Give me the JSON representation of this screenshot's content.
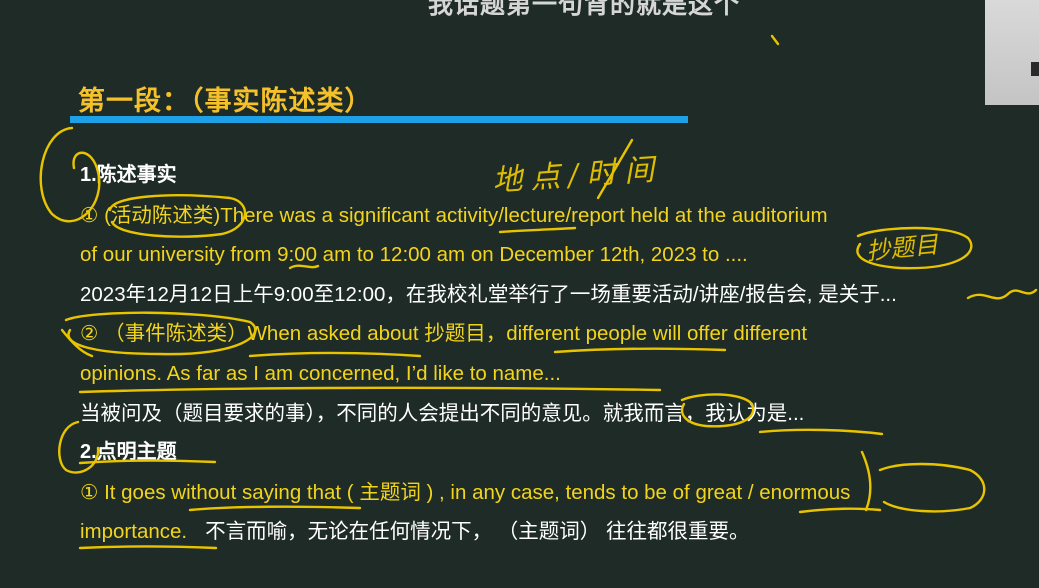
{
  "video": {
    "subtitle": "我话题第一句背的就是这个"
  },
  "slide": {
    "heading": "第一段：（事实陈述类）",
    "lines": [
      {
        "text": "1.陈述事实"
      },
      {
        "text": "① (活动陈述类)There was a significant activity/lecture/report held at the auditorium"
      },
      {
        "text": "of our university from 9:00 am to 12:00 am on December 12th, 2023 to ...."
      },
      {
        "text": "2023年12月12日上午9:00至12:00，在我校礼堂举行了一场重要活动/讲座/报告会, 是关于..."
      },
      {
        "text": "② （事件陈述类）When asked about 抄题目，different people will offer different"
      },
      {
        "text": "opinions. As far as I am concerned, I’d like to name..."
      },
      {
        "text": "当被问及（题目要求的事），不同的人会提出不同的意见。就我而言，我认为是..."
      },
      {
        "text": "2.点明主题"
      },
      {
        "text": "① It goes without saying that ( 主题词 ) , in any case, tends to be of great / enormous"
      },
      {
        "text": "importance.",
        "translation": "不言而喻，无论在任何情况下，  （主题词） 往往都很重要。"
      }
    ]
  },
  "annotations": {
    "location_time": "地点/时间",
    "copy_topic": "抄题目"
  },
  "colors": {
    "background": "#1f2b27",
    "heading": "#f5c12a",
    "accent_bar": "#1ea0e6",
    "highlight_text": "#f2d41c",
    "body_text": "#ffffff",
    "handwriting": "#e8c400"
  }
}
